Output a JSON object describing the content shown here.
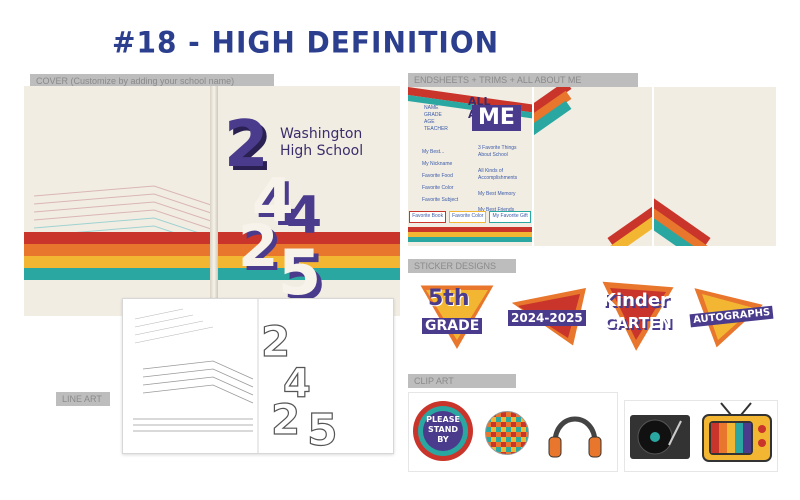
{
  "header": {
    "title": "#18 - HIGH DEFINITION"
  },
  "captions": {
    "cover": "COVER (Customize by adding your school name)",
    "interior": "ENDSHEETS + TRIMS + ALL ABOUT ME",
    "stickers": "STICKER DESIGNS",
    "art": "CLIP ART",
    "lineart": "LINE ART"
  },
  "cover": {
    "school_line1": "Washington",
    "school_line2": "High School",
    "digits": [
      "2",
      "4",
      "2",
      "5"
    ]
  },
  "about_me": {
    "title_line1": "ALL ABOUT",
    "title_line2": "ME",
    "side_labels": [
      "NAME",
      "GRADE",
      "AGE",
      "TEACHER"
    ],
    "fields_left": [
      "My Best...",
      "My Nickname",
      "Favorite Food",
      "Favorite Color",
      "Favorite Subject"
    ],
    "fields_right": [
      "3 Favorite Things About School",
      "All Kinds of Accomplishments",
      "My Best Memory",
      "My Best Friends"
    ],
    "tabs": [
      "Favorite Book",
      "Favorite Color",
      "My Favorite Gift"
    ]
  },
  "stickers": [
    {
      "line1": "5th",
      "line2": "GRADE"
    },
    {
      "line1": "2024-2025",
      "line2": ""
    },
    {
      "line1": "Kinder",
      "line2": "GARTEN"
    },
    {
      "line1": "AUTOGRAPHS",
      "line2": ""
    }
  ],
  "clip_art": {
    "badge_lines": [
      "PLEASE",
      "STAND",
      "BY"
    ],
    "items": [
      "badge",
      "disco-ball",
      "headphones",
      "turntable",
      "tv"
    ]
  },
  "colors": {
    "title": "#2c3f8f",
    "red": "#c9342b",
    "orange": "#e8762c",
    "yellow": "#f3b632",
    "teal": "#2aa7a1",
    "purple": "#4a3b8c",
    "paper": "#f2ede3"
  }
}
